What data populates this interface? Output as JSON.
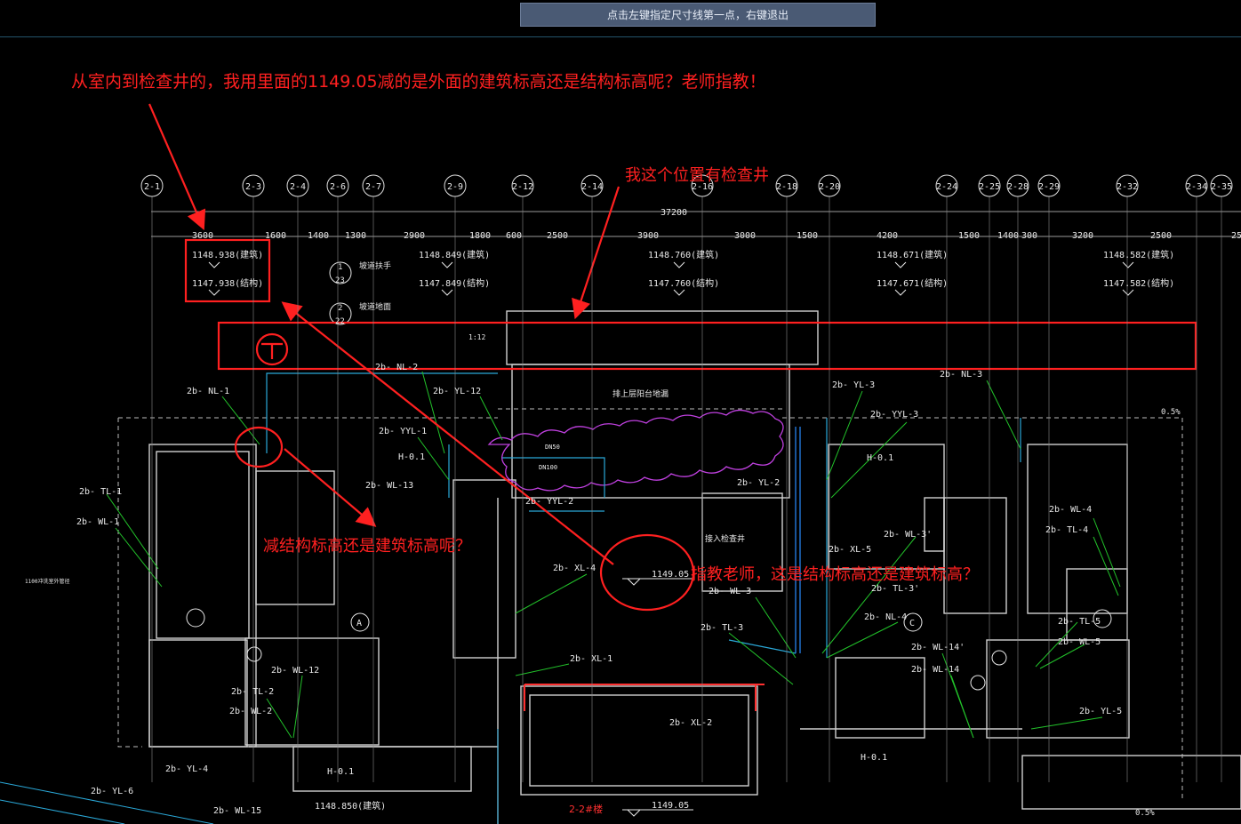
{
  "status_prompt": "点击左键指定尺寸线第一点，右键退出",
  "annotations": {
    "top_question": "从室内到检查井的，我用里面的1149.05减的是外面的建筑标高还是结构标高呢？老师指教！",
    "inspection_well": "我这个位置有检查井",
    "mid_question": "减结构标高还是建筑标高呢？",
    "right_question": "指教老师，这是结构标高还是建筑标高？"
  },
  "grid_axes": [
    "2-1",
    "2-3",
    "2-4",
    "2-6",
    "2-7",
    "2-9",
    "2-12",
    "2-14",
    "2-16",
    "2-18",
    "2-20",
    "2-24",
    "2-25",
    "2-28",
    "2-29",
    "2-32",
    "2-34",
    "2-35"
  ],
  "overall_dim": "37200",
  "dims": [
    "3600",
    "1600",
    "1400",
    "1300",
    "2900",
    "1800",
    "600",
    "2500",
    "3900",
    "3000",
    "1500",
    "4200",
    "1500",
    "1400",
    "300",
    "3200",
    "2500",
    "25"
  ],
  "elevations": {
    "e1_arch": "1148.938(建筑)",
    "e1_struct": "1147.938(结构)",
    "e2_arch": "1148.849(建筑)",
    "e2_struct": "1147.849(结构)",
    "e3_arch": "1148.760(建筑)",
    "e3_struct": "1147.760(结构)",
    "e4_arch": "1148.671(建筑)",
    "e4_struct": "1147.671(结构)",
    "e5_arch": "1148.582(建筑)",
    "e5_struct": "1147.582(结构)",
    "indoor": "1149.05",
    "indoor2": "1149.05",
    "bottom": "1148.850(建筑)"
  },
  "cad_labels": {
    "nl1": "2b- NL-1",
    "nl2": "2b- NL-2",
    "yl12": "2b- YL-12",
    "yyl1": "2b- YYL-1",
    "h01a": "H-0.1",
    "wl13": "2b- WL-13",
    "tl1": "2b- TL-1",
    "wl1": "2b- WL-1",
    "yyl2": "2b- YYL-2",
    "xl4": "2b- XL-4",
    "wl12": "2b- WL-12",
    "tl2": "2b- TL-2",
    "wl2": "2b- WL-2",
    "yl4": "2b- YL-4",
    "yl6": "2b- YL-6",
    "wl15": "2b- WL-15",
    "h01b": "H-0.1",
    "xl1": "2b- XL-1",
    "xl2": "2b- XL-2",
    "yl3": "2b- YL-3",
    "yyl3": "2b- YYL-3",
    "nl3": "2b- NL-3",
    "yl2": "2b- YL-2",
    "h01c": "H-0.1",
    "xl5": "2b- XL-5",
    "wl3": "2b- WL-3'",
    "tl3a": "2b- TL-3'",
    "wl3b": "2b- WL-3",
    "tl3": "2b- TL-3",
    "nl4": "2b- NL-4",
    "wl14a": "2b- WL-14'",
    "wl14": "2b- WL-14",
    "wl4": "2b- WL-4",
    "tl4": "2b- TL-4",
    "tl5": "2b- TL-5",
    "wl5": "2b- WL-5",
    "yl5": "2b- YL-5",
    "h01d": "H-0.1",
    "stair": "2-2#楼",
    "drain": "排上层阳台地漏",
    "well_pipe": "接入检查井",
    "slope": "0.5%",
    "slope2": "0.5%",
    "p112": "1:12",
    "axisA": "A",
    "axisC": "C",
    "dn50": "DN50",
    "dn100": "DN100",
    "n1": "1",
    "n23": "23",
    "n2": "2",
    "n22": "22",
    "bq1": "坡道扶手",
    "bq2": "坡道地面",
    "sec": "1100冲洗室外管径"
  },
  "colors": {
    "cad_white": "#e8e8e8",
    "cad_green": "#22c22a",
    "cad_cyan": "#2aa8d8",
    "cad_magenta": "#c040e0",
    "annotation_red": "#ff2020",
    "grid_line": "#a0a0a0"
  }
}
